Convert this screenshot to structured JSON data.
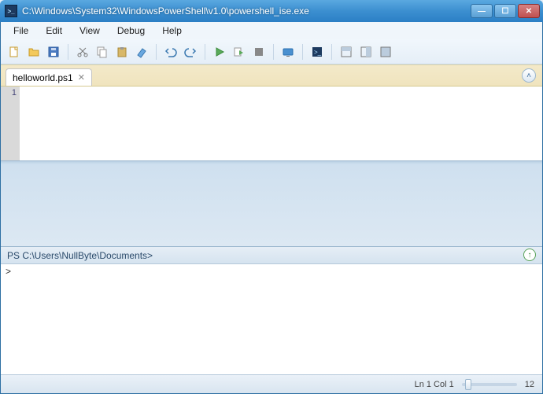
{
  "window": {
    "title": "C:\\Windows\\System32\\WindowsPowerShell\\v1.0\\powershell_ise.exe"
  },
  "menu": {
    "file": "File",
    "edit": "Edit",
    "view": "View",
    "debug": "Debug",
    "help": "Help"
  },
  "toolbar_icons": {
    "new": "new-file-icon",
    "open": "open-folder-icon",
    "save": "save-icon",
    "cut": "cut-icon",
    "copy": "copy-icon",
    "paste": "paste-icon",
    "clear": "clear-icon",
    "undo": "undo-icon",
    "redo": "redo-icon",
    "run": "run-selection-icon",
    "runscript": "run-script-icon",
    "stop": "stop-icon",
    "remote": "remote-icon",
    "powershell": "powershell-icon",
    "layout1": "show-script-top-icon",
    "layout2": "show-script-right-icon",
    "layout3": "show-script-max-icon"
  },
  "tabs": [
    {
      "label": "helloworld.ps1"
    }
  ],
  "editor": {
    "line_numbers": [
      "1"
    ]
  },
  "console": {
    "prompt": "PS C:\\Users\\NullByte\\Documents>",
    "input_marker": ">"
  },
  "status": {
    "position": "Ln 1  Col 1",
    "zoom": "12"
  }
}
